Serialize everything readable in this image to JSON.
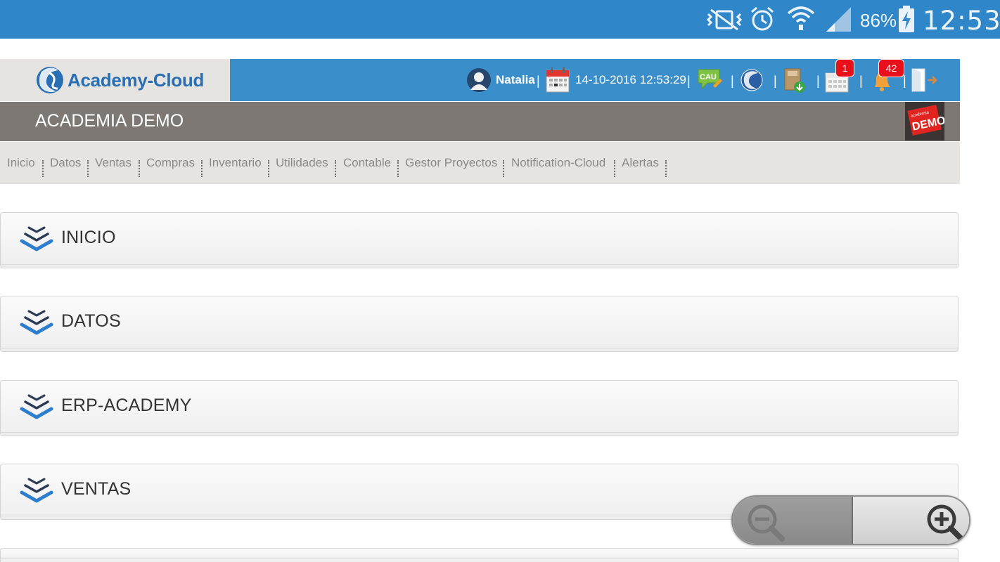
{
  "status_bar": {
    "icons": [
      "vibrate-mute-icon",
      "alarm-icon",
      "wifi-icon",
      "signal-icon",
      "battery-charging-icon"
    ],
    "battery_percent": "86%",
    "time": "12:53"
  },
  "header": {
    "app_name": "Academy-Cloud",
    "user_name": "Natalia",
    "separator": "|",
    "datetime": "14-10-2016 12:53:29",
    "cau_label": "CAU",
    "calendar_badge": "1",
    "alerts_badge": "42"
  },
  "academia": {
    "title": "ACADEMIA DEMO",
    "logo_text_top": "academia",
    "logo_text_main": "DEMO"
  },
  "menu": {
    "items": [
      "Inicio",
      "Datos",
      "Ventas",
      "Compras",
      "Inventario",
      "Utilidades",
      "Contable",
      "Gestor Proyectos",
      "Notification-Cloud",
      "Alertas"
    ]
  },
  "panels": [
    {
      "title": "INICIO"
    },
    {
      "title": "DATOS"
    },
    {
      "title": "ERP-ACADEMY"
    },
    {
      "title": "VENTAS"
    }
  ],
  "colors": {
    "status_bar": "#2f86c8",
    "header_blue": "#3a8fcb",
    "academia_band": "#7d7874",
    "menu_background": "#e6e4e1",
    "badge_red": "#e8101b"
  }
}
